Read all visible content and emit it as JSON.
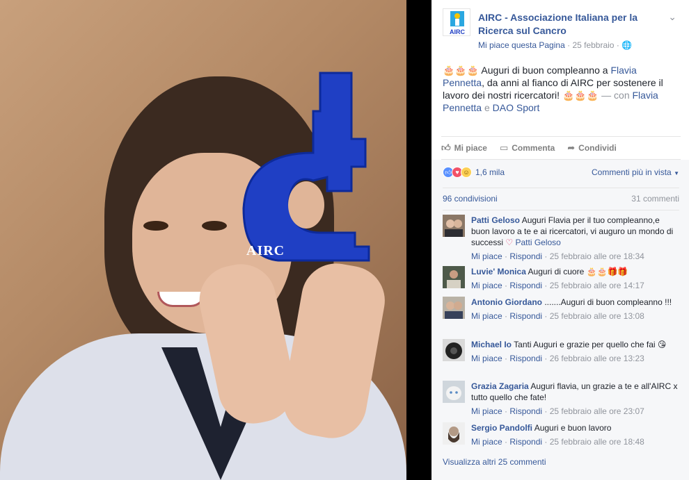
{
  "post": {
    "page_name": "AIRC - Associazione Italiana per la Ricerca sul Cancro",
    "avatar_label": "AIRC",
    "like_page": "Mi piace questa Pagina",
    "date": "25 febbraio",
    "text_pre": "🎂🎂🎂 Auguri di buon compleanno a ",
    "tag1": "Flavia Pennetta",
    "text_mid": ", da anni al fianco di AIRC per sostenere il lavoro dei nostri ricercatori! 🎂🎂🎂 ",
    "with": "— con ",
    "tag2": "Flavia Pennetta",
    "and": " e ",
    "tag3": "DAO Sport"
  },
  "photo": {
    "trophy_text": "AIRC"
  },
  "actions": {
    "like": "Mi piace",
    "comment": "Commenta",
    "share": "Condividi"
  },
  "reactions": {
    "count": "1,6 mila",
    "filter": "Commenti più in vista"
  },
  "stats": {
    "shares": "96 condivisioni",
    "comments": "31 commenti"
  },
  "comments": [
    {
      "author": "Patti Geloso",
      "text": "Auguri Flavia per il tuo compleanno,e buon lavoro a te e ai ricercatori, vi auguro un mondo di successi",
      "tag": "Patti Geloso",
      "time": "25 febbraio alle ore 18:34"
    },
    {
      "author": "Luvie' Monica",
      "text": "Auguri di cuore 🎂🎂🎁🎁",
      "time": "25 febbraio alle ore 14:17"
    },
    {
      "author": "Antonio Giordano",
      "text": ".......Auguri di buon compleanno !!!",
      "time": "25 febbraio alle ore 13:08"
    },
    {
      "author": "Michael Io",
      "text": "Tanti Auguri e grazie per quello che fai 😘",
      "time": "26 febbraio alle ore 13:23"
    },
    {
      "author": "Grazia Zagaria",
      "text": "Auguri flavia, un grazie a te e all'AIRC x tutto quello che fate!",
      "time": "25 febbraio alle ore 23:07"
    },
    {
      "author": "Sergio Pandolfi",
      "text": "Auguri e buon lavoro",
      "time": "25 febbraio alle ore 18:48"
    }
  ],
  "comment_actions": {
    "like": "Mi piace",
    "reply": "Rispondi",
    "sep": " · "
  },
  "view_more": "Visualizza altri 25 commenti",
  "colors": {
    "link": "#365899",
    "meta": "#90949c",
    "trophy": "#1f3fc4"
  }
}
